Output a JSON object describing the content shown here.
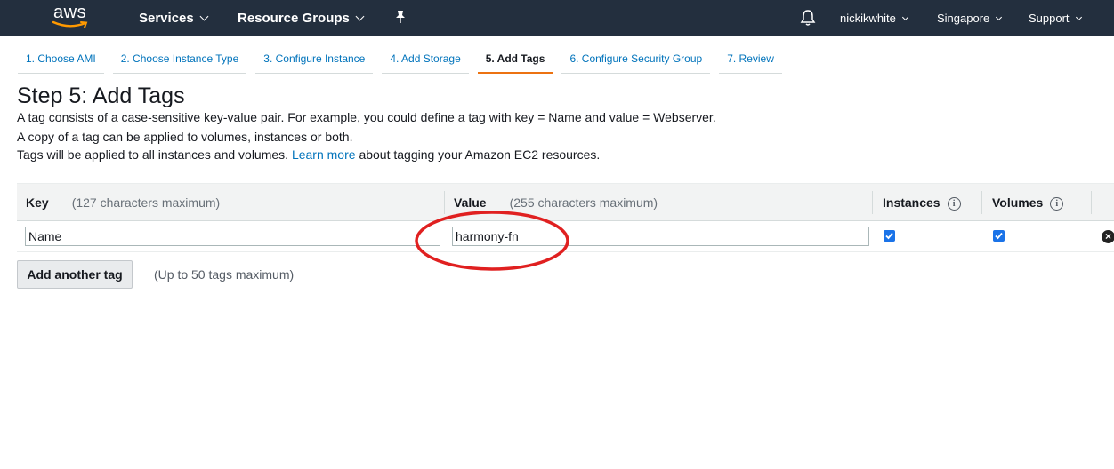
{
  "topnav": {
    "logo_text": "aws",
    "services_label": "Services",
    "resource_groups_label": "Resource Groups",
    "user_label": "nickikwhite",
    "region_label": "Singapore",
    "support_label": "Support",
    "background_color": "#232f3e",
    "icons": [
      "pin-icon",
      "bell-icon",
      "chevron-down-icon"
    ]
  },
  "wizard": {
    "steps": [
      {
        "label": "1. Choose AMI",
        "active": false
      },
      {
        "label": "2. Choose Instance Type",
        "active": false
      },
      {
        "label": "3. Configure Instance",
        "active": false
      },
      {
        "label": "4. Add Storage",
        "active": false
      },
      {
        "label": "5. Add Tags",
        "active": true
      },
      {
        "label": "6. Configure Security Group",
        "active": false
      },
      {
        "label": "7. Review",
        "active": false
      }
    ],
    "accent_color": "#ec7211"
  },
  "page": {
    "title": "Step 5: Add Tags",
    "desc_line1": "A tag consists of a case-sensitive key-value pair. For example, you could define a tag with key = Name and value = Webserver.",
    "desc_line2": "A copy of a tag can be applied to volumes, instances or both.",
    "desc_line3_pre": "Tags will be applied to all instances and volumes.",
    "learn_more": "Learn more",
    "desc_line3_post": "about tagging your Amazon EC2 resources."
  },
  "table": {
    "headers": {
      "key": "Key",
      "key_hint": "(127 characters maximum)",
      "value": "Value",
      "value_hint": "(255 characters maximum)",
      "instances": "Instances",
      "volumes": "Volumes"
    },
    "rows": [
      {
        "key": "Name",
        "value": "harmony-fn",
        "instances": true,
        "volumes": true
      }
    ]
  },
  "actions": {
    "add_tag_label": "Add another tag",
    "add_tag_note": "(Up to 50 tags maximum)"
  },
  "annotation": {
    "color": "#e02020",
    "shape": "ellipse-around-value-field"
  }
}
